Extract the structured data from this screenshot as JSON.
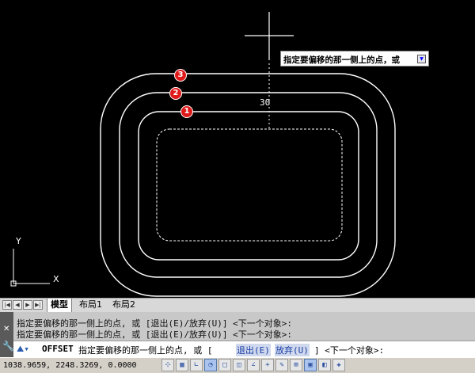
{
  "tooltip": {
    "text": "指定要偏移的那一侧上的点，或"
  },
  "dimension": {
    "value": "30"
  },
  "badges": [
    "1",
    "2",
    "3"
  ],
  "ucs": {
    "x_label": "X",
    "y_label": "Y"
  },
  "layout_tabs": [
    "模型",
    "布局1",
    "布局2"
  ],
  "command": {
    "history": [
      "指定要偏移的那一侧上的点, 或 [退出(E)/放弃(U)] <下一个对象>:",
      "指定要偏移的那一侧上的点, 或 [退出(E)/放弃(U)] <下一个对象>:"
    ],
    "cmd_name": "OFFSET",
    "prompt": "指定要偏移的那一侧上的点, 或 [",
    "option1": "退出(E)",
    "option2": "放弃(U)",
    "prompt_end": "] <下一个对象>:"
  },
  "status": {
    "coords": "1038.9659, 2248.3269, 0.0000",
    "buttons": [
      "snap-icon",
      "grid-icon",
      "ortho-icon",
      "polar-icon",
      "osnap-icon",
      "otrack-icon",
      "ducs-icon",
      "dyn-icon",
      "lwt-icon",
      "qp-icon",
      "sc-icon",
      "am-icon",
      "model-icon"
    ]
  }
}
